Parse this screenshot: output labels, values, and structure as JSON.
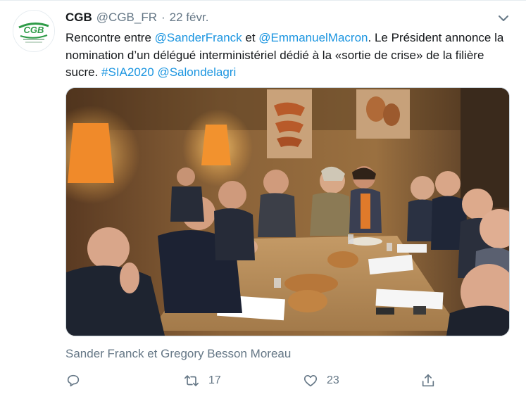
{
  "author": {
    "display_name": "CGB",
    "handle": "@CGB_FR",
    "separator": "·",
    "date": "22 févr.",
    "avatar_text": "CGB"
  },
  "tweet": {
    "segments": [
      {
        "text": "Rencontre entre ",
        "link": false
      },
      {
        "text": "@SanderFranck",
        "link": true
      },
      {
        "text": " et ",
        "link": false
      },
      {
        "text": "@EmmanuelMacron",
        "link": true
      },
      {
        "text": ". Le Président annonce la nomination d’un délégué interministériel dédié à la «sortie de crise» de la filière sucre. ",
        "link": false
      },
      {
        "text": "#SIA2020",
        "link": true
      },
      {
        "text": " ",
        "link": false
      },
      {
        "text": "@Salondelagri",
        "link": true
      }
    ]
  },
  "media": {
    "icon": "photo-meeting-image"
  },
  "caption": "Sander Franck et Gregory Besson Moreau",
  "actions": {
    "reply": {
      "icon": "reply-icon",
      "count": ""
    },
    "retweet": {
      "icon": "retweet-icon",
      "count": "17"
    },
    "like": {
      "icon": "heart-icon",
      "count": "23"
    },
    "share": {
      "icon": "share-icon",
      "count": ""
    }
  },
  "colors": {
    "link": "#1b95e0",
    "secondary_text": "#657786",
    "brand_green": "#2e9b47"
  }
}
